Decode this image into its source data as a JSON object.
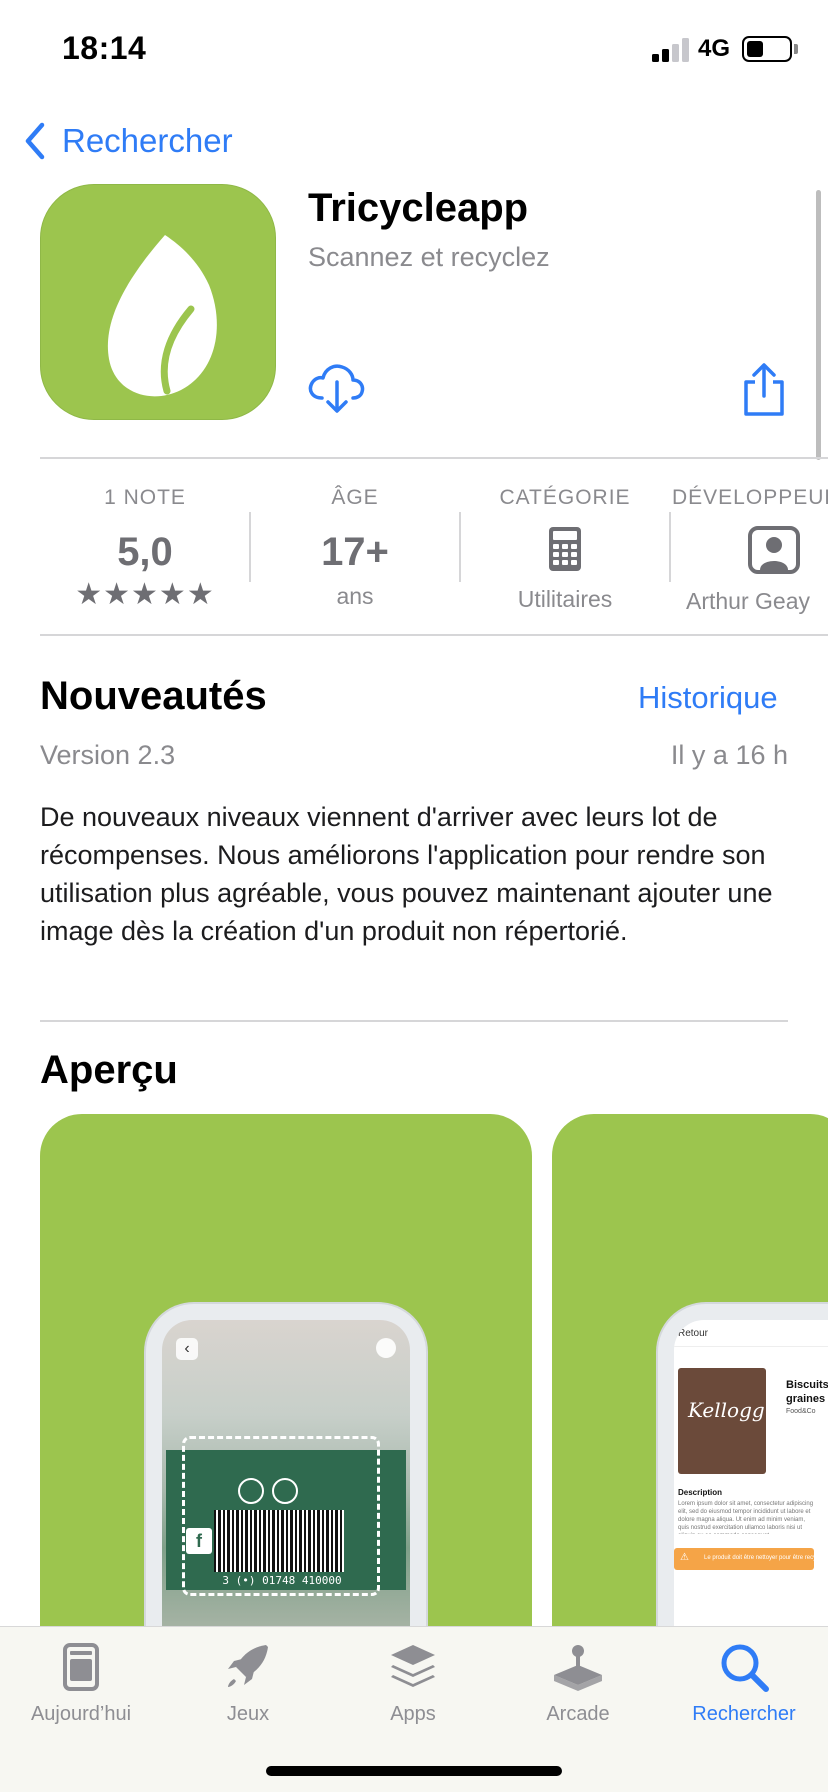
{
  "status_bar": {
    "time": "18:14",
    "network": "4G",
    "signal_bars_active": 2,
    "signal_bars_total": 4,
    "battery_level": 0.4
  },
  "nav": {
    "back_label": "Rechercher"
  },
  "app": {
    "name": "Tricycleapp",
    "subtitle": "Scannez et recyclez",
    "icon_color": "#9cc54e",
    "icon": "leaf-icon"
  },
  "info": {
    "rating": {
      "heading": "1 NOTE",
      "value": "5,0",
      "stars": "★★★★★"
    },
    "age": {
      "heading": "ÂGE",
      "value": "17+",
      "sub": "ans"
    },
    "category": {
      "heading": "CATÉGORIE",
      "sub": "Utilitaires",
      "icon": "calculator-icon"
    },
    "developer": {
      "heading": "DÉVELOPPEUR",
      "sub": "Arthur Geay",
      "icon": "person-icon"
    }
  },
  "whats_new": {
    "title": "Nouveautés",
    "history_label": "Historique",
    "version": "Version 2.3",
    "date": "Il y a 16 h",
    "notes": "De nouveaux niveaux viennent d'arriver avec leurs lot de récompenses. Nous améliorons l'application pour rendre son utilisation plus agréable, vous pouvez maintenant ajouter une image dès la création d'un produit non répertorié."
  },
  "preview": {
    "title": "Aperçu",
    "screens": [
      {
        "kind": "barcode-scanner",
        "barcode_text": "3 (•) 01748 410000"
      },
      {
        "kind": "product-detail",
        "back_label": "Retour",
        "product_title": "Biscuits graines",
        "brand": "Food&Co",
        "box_brand": "Kellogg",
        "description_label": "Description",
        "description_text": "Lorem ipsum dolor sit amet, consectetur adipiscing elit, sed do eiusmod tempor incididunt ut labore et dolore magna aliqua. Ut enim ad minim veniam, quis nostrud exercitation ullamco laboris nisi ut aliquip ex ea commodo consequat.",
        "warning_text": "Le produit doit être nettoyer pour être recyclé"
      }
    ]
  },
  "tab_bar": {
    "tabs": [
      {
        "label": "Aujourd’hui",
        "icon": "today-icon",
        "active": false
      },
      {
        "label": "Jeux",
        "icon": "rocket-icon",
        "active": false
      },
      {
        "label": "Apps",
        "icon": "apps-stack-icon",
        "active": false
      },
      {
        "label": "Arcade",
        "icon": "arcade-joystick-icon",
        "active": false
      },
      {
        "label": "Rechercher",
        "icon": "search-icon",
        "active": true
      }
    ],
    "active_color": "#2f7cf6",
    "inactive_color": "#8e8e93"
  }
}
